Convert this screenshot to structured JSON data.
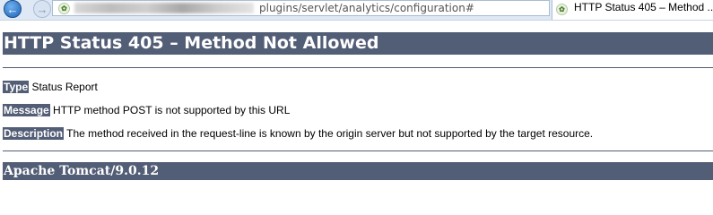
{
  "browser": {
    "url_path": "plugins/servlet/analytics/configuration#",
    "tab_title": "HTTP Status 405 – Method ...",
    "icons": {
      "back": "back-arrow-icon",
      "forward": "forward-arrow-icon",
      "search": "search-icon",
      "refresh": "refresh-icon"
    }
  },
  "page": {
    "heading": "HTTP Status 405 – Method Not Allowed",
    "type_label": "Type",
    "type_value": "Status Report",
    "message_label": "Message",
    "message_value": "HTTP method POST is not supported by this URL",
    "description_label": "Description",
    "description_value": "The method received in the request-line is known by the origin server but not supported by the target resource.",
    "footer": "Apache Tomcat/9.0.12"
  },
  "colors": {
    "bar": "#525d76",
    "chrome": "#dfe9f5"
  }
}
